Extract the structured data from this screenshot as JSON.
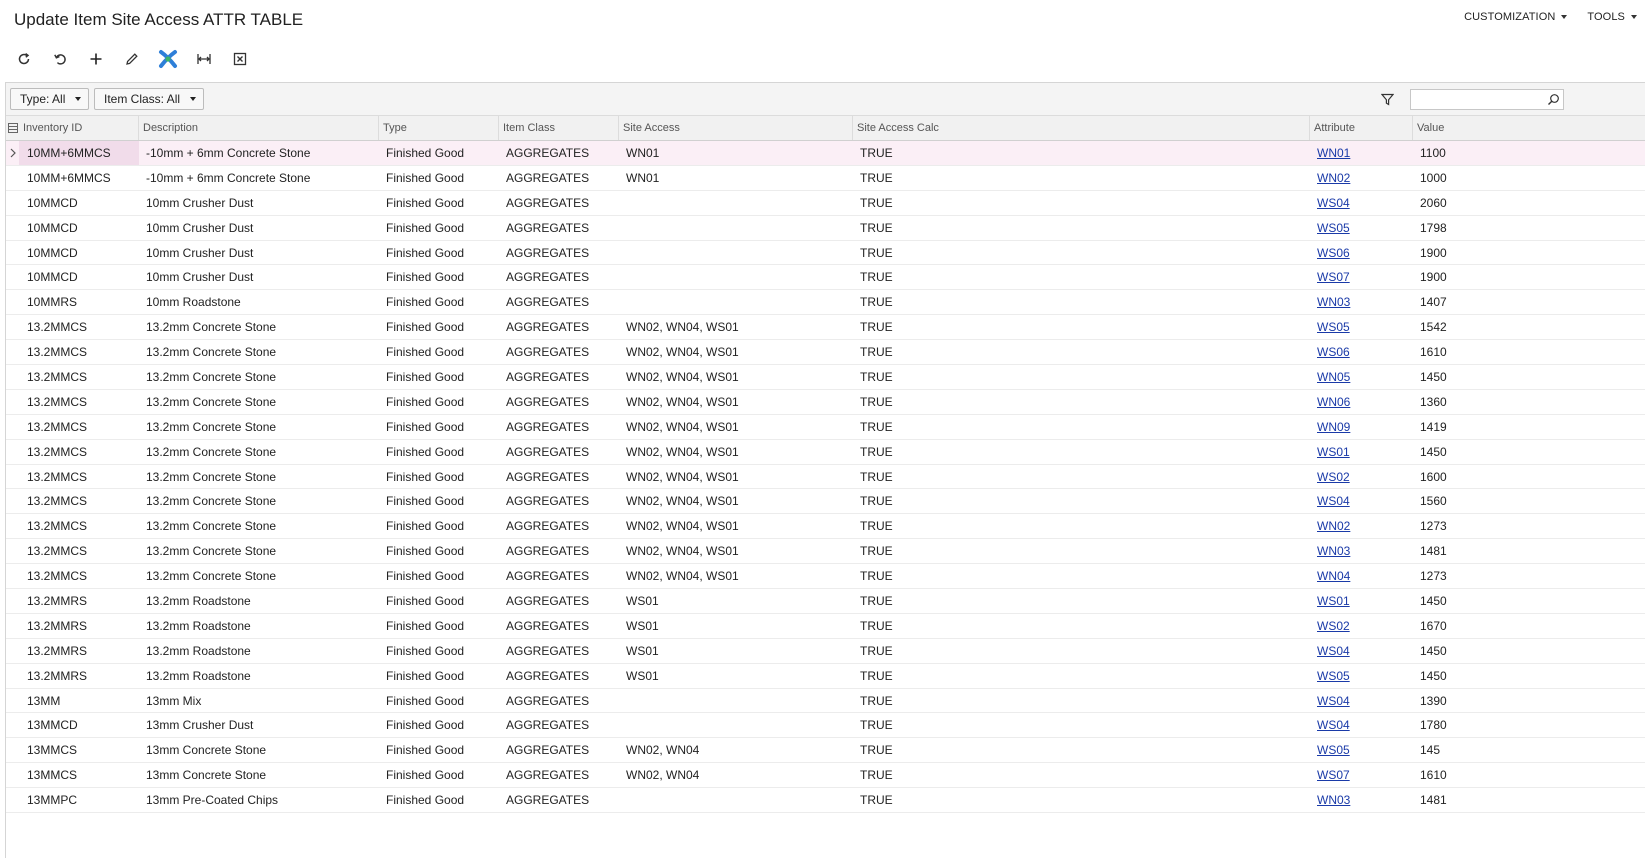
{
  "header": {
    "title": "Update Item Site Access ATTR TABLE",
    "menu": [
      {
        "label": "CUSTOMIZATION"
      },
      {
        "label": "TOOLS"
      }
    ]
  },
  "toolbar": {
    "buttons": [
      "refresh-icon",
      "undo-icon",
      "add-icon",
      "edit-icon",
      "integration-icon",
      "fit-columns-icon",
      "export-excel-icon"
    ]
  },
  "filters": {
    "type": "Type: All",
    "item_class": "Item Class: All"
  },
  "search": {
    "value": "",
    "placeholder": ""
  },
  "columns": [
    "Inventory ID",
    "Description",
    "Type",
    "Item Class",
    "Site Access",
    "Site Access Calc",
    "Attribute",
    "Value"
  ],
  "colors": {
    "active_row": "#fbeff6",
    "link": "#1a3aa8",
    "accent_blue": "#2e7fd8",
    "accent_green": "#3bb36a"
  },
  "rows": [
    {
      "inv": "10MM+6MMCS",
      "desc": "-10mm + 6mm Concrete Stone",
      "type": "Finished Good",
      "cls": "AGGREGATES",
      "site": "WN01",
      "calc": "TRUE",
      "attr": "WN01",
      "val": "1100"
    },
    {
      "inv": "10MM+6MMCS",
      "desc": "-10mm + 6mm Concrete Stone",
      "type": "Finished Good",
      "cls": "AGGREGATES",
      "site": "WN01",
      "calc": "TRUE",
      "attr": "WN02",
      "val": "1000"
    },
    {
      "inv": "10MMCD",
      "desc": "10mm Crusher Dust",
      "type": "Finished Good",
      "cls": "AGGREGATES",
      "site": "",
      "calc": "TRUE",
      "attr": "WS04",
      "val": "2060"
    },
    {
      "inv": "10MMCD",
      "desc": "10mm Crusher Dust",
      "type": "Finished Good",
      "cls": "AGGREGATES",
      "site": "",
      "calc": "TRUE",
      "attr": "WS05",
      "val": "1798"
    },
    {
      "inv": "10MMCD",
      "desc": "10mm Crusher Dust",
      "type": "Finished Good",
      "cls": "AGGREGATES",
      "site": "",
      "calc": "TRUE",
      "attr": "WS06",
      "val": "1900"
    },
    {
      "inv": "10MMCD",
      "desc": "10mm Crusher Dust",
      "type": "Finished Good",
      "cls": "AGGREGATES",
      "site": "",
      "calc": "TRUE",
      "attr": "WS07",
      "val": "1900"
    },
    {
      "inv": "10MMRS",
      "desc": "10mm Roadstone",
      "type": "Finished Good",
      "cls": "AGGREGATES",
      "site": "",
      "calc": "TRUE",
      "attr": "WN03",
      "val": "1407"
    },
    {
      "inv": "13.2MMCS",
      "desc": "13.2mm Concrete Stone",
      "type": "Finished Good",
      "cls": "AGGREGATES",
      "site": "WN02, WN04, WS01",
      "calc": "TRUE",
      "attr": "WS05",
      "val": "1542"
    },
    {
      "inv": "13.2MMCS",
      "desc": "13.2mm Concrete Stone",
      "type": "Finished Good",
      "cls": "AGGREGATES",
      "site": "WN02, WN04, WS01",
      "calc": "TRUE",
      "attr": "WS06",
      "val": "1610"
    },
    {
      "inv": "13.2MMCS",
      "desc": "13.2mm Concrete Stone",
      "type": "Finished Good",
      "cls": "AGGREGATES",
      "site": "WN02, WN04, WS01",
      "calc": "TRUE",
      "attr": "WN05",
      "val": "1450"
    },
    {
      "inv": "13.2MMCS",
      "desc": "13.2mm Concrete Stone",
      "type": "Finished Good",
      "cls": "AGGREGATES",
      "site": "WN02, WN04, WS01",
      "calc": "TRUE",
      "attr": "WN06",
      "val": "1360"
    },
    {
      "inv": "13.2MMCS",
      "desc": "13.2mm Concrete Stone",
      "type": "Finished Good",
      "cls": "AGGREGATES",
      "site": "WN02, WN04, WS01",
      "calc": "TRUE",
      "attr": "WN09",
      "val": "1419"
    },
    {
      "inv": "13.2MMCS",
      "desc": "13.2mm Concrete Stone",
      "type": "Finished Good",
      "cls": "AGGREGATES",
      "site": "WN02, WN04, WS01",
      "calc": "TRUE",
      "attr": "WS01",
      "val": "1450"
    },
    {
      "inv": "13.2MMCS",
      "desc": "13.2mm Concrete Stone",
      "type": "Finished Good",
      "cls": "AGGREGATES",
      "site": "WN02, WN04, WS01",
      "calc": "TRUE",
      "attr": "WS02",
      "val": "1600"
    },
    {
      "inv": "13.2MMCS",
      "desc": "13.2mm Concrete Stone",
      "type": "Finished Good",
      "cls": "AGGREGATES",
      "site": "WN02, WN04, WS01",
      "calc": "TRUE",
      "attr": "WS04",
      "val": "1560"
    },
    {
      "inv": "13.2MMCS",
      "desc": "13.2mm Concrete Stone",
      "type": "Finished Good",
      "cls": "AGGREGATES",
      "site": "WN02, WN04, WS01",
      "calc": "TRUE",
      "attr": "WN02",
      "val": "1273"
    },
    {
      "inv": "13.2MMCS",
      "desc": "13.2mm Concrete Stone",
      "type": "Finished Good",
      "cls": "AGGREGATES",
      "site": "WN02, WN04, WS01",
      "calc": "TRUE",
      "attr": "WN03",
      "val": "1481"
    },
    {
      "inv": "13.2MMCS",
      "desc": "13.2mm Concrete Stone",
      "type": "Finished Good",
      "cls": "AGGREGATES",
      "site": "WN02, WN04, WS01",
      "calc": "TRUE",
      "attr": "WN04",
      "val": "1273"
    },
    {
      "inv": "13.2MMRS",
      "desc": "13.2mm Roadstone",
      "type": "Finished Good",
      "cls": "AGGREGATES",
      "site": "WS01",
      "calc": "TRUE",
      "attr": "WS01",
      "val": "1450"
    },
    {
      "inv": "13.2MMRS",
      "desc": "13.2mm Roadstone",
      "type": "Finished Good",
      "cls": "AGGREGATES",
      "site": "WS01",
      "calc": "TRUE",
      "attr": "WS02",
      "val": "1670"
    },
    {
      "inv": "13.2MMRS",
      "desc": "13.2mm Roadstone",
      "type": "Finished Good",
      "cls": "AGGREGATES",
      "site": "WS01",
      "calc": "TRUE",
      "attr": "WS04",
      "val": "1450"
    },
    {
      "inv": "13.2MMRS",
      "desc": "13.2mm Roadstone",
      "type": "Finished Good",
      "cls": "AGGREGATES",
      "site": "WS01",
      "calc": "TRUE",
      "attr": "WS05",
      "val": "1450"
    },
    {
      "inv": "13MM",
      "desc": "13mm Mix",
      "type": "Finished Good",
      "cls": "AGGREGATES",
      "site": "",
      "calc": "TRUE",
      "attr": "WS04",
      "val": "1390"
    },
    {
      "inv": "13MMCD",
      "desc": "13mm Crusher Dust",
      "type": "Finished Good",
      "cls": "AGGREGATES",
      "site": "",
      "calc": "TRUE",
      "attr": "WS04",
      "val": "1780"
    },
    {
      "inv": "13MMCS",
      "desc": "13mm Concrete Stone",
      "type": "Finished Good",
      "cls": "AGGREGATES",
      "site": "WN02, WN04",
      "calc": "TRUE",
      "attr": "WS05",
      "val": "145"
    },
    {
      "inv": "13MMCS",
      "desc": "13mm Concrete Stone",
      "type": "Finished Good",
      "cls": "AGGREGATES",
      "site": "WN02, WN04",
      "calc": "TRUE",
      "attr": "WS07",
      "val": "1610"
    },
    {
      "inv": "13MMPC",
      "desc": "13mm Pre-Coated Chips",
      "type": "Finished Good",
      "cls": "AGGREGATES",
      "site": "",
      "calc": "TRUE",
      "attr": "WN03",
      "val": "1481"
    }
  ]
}
